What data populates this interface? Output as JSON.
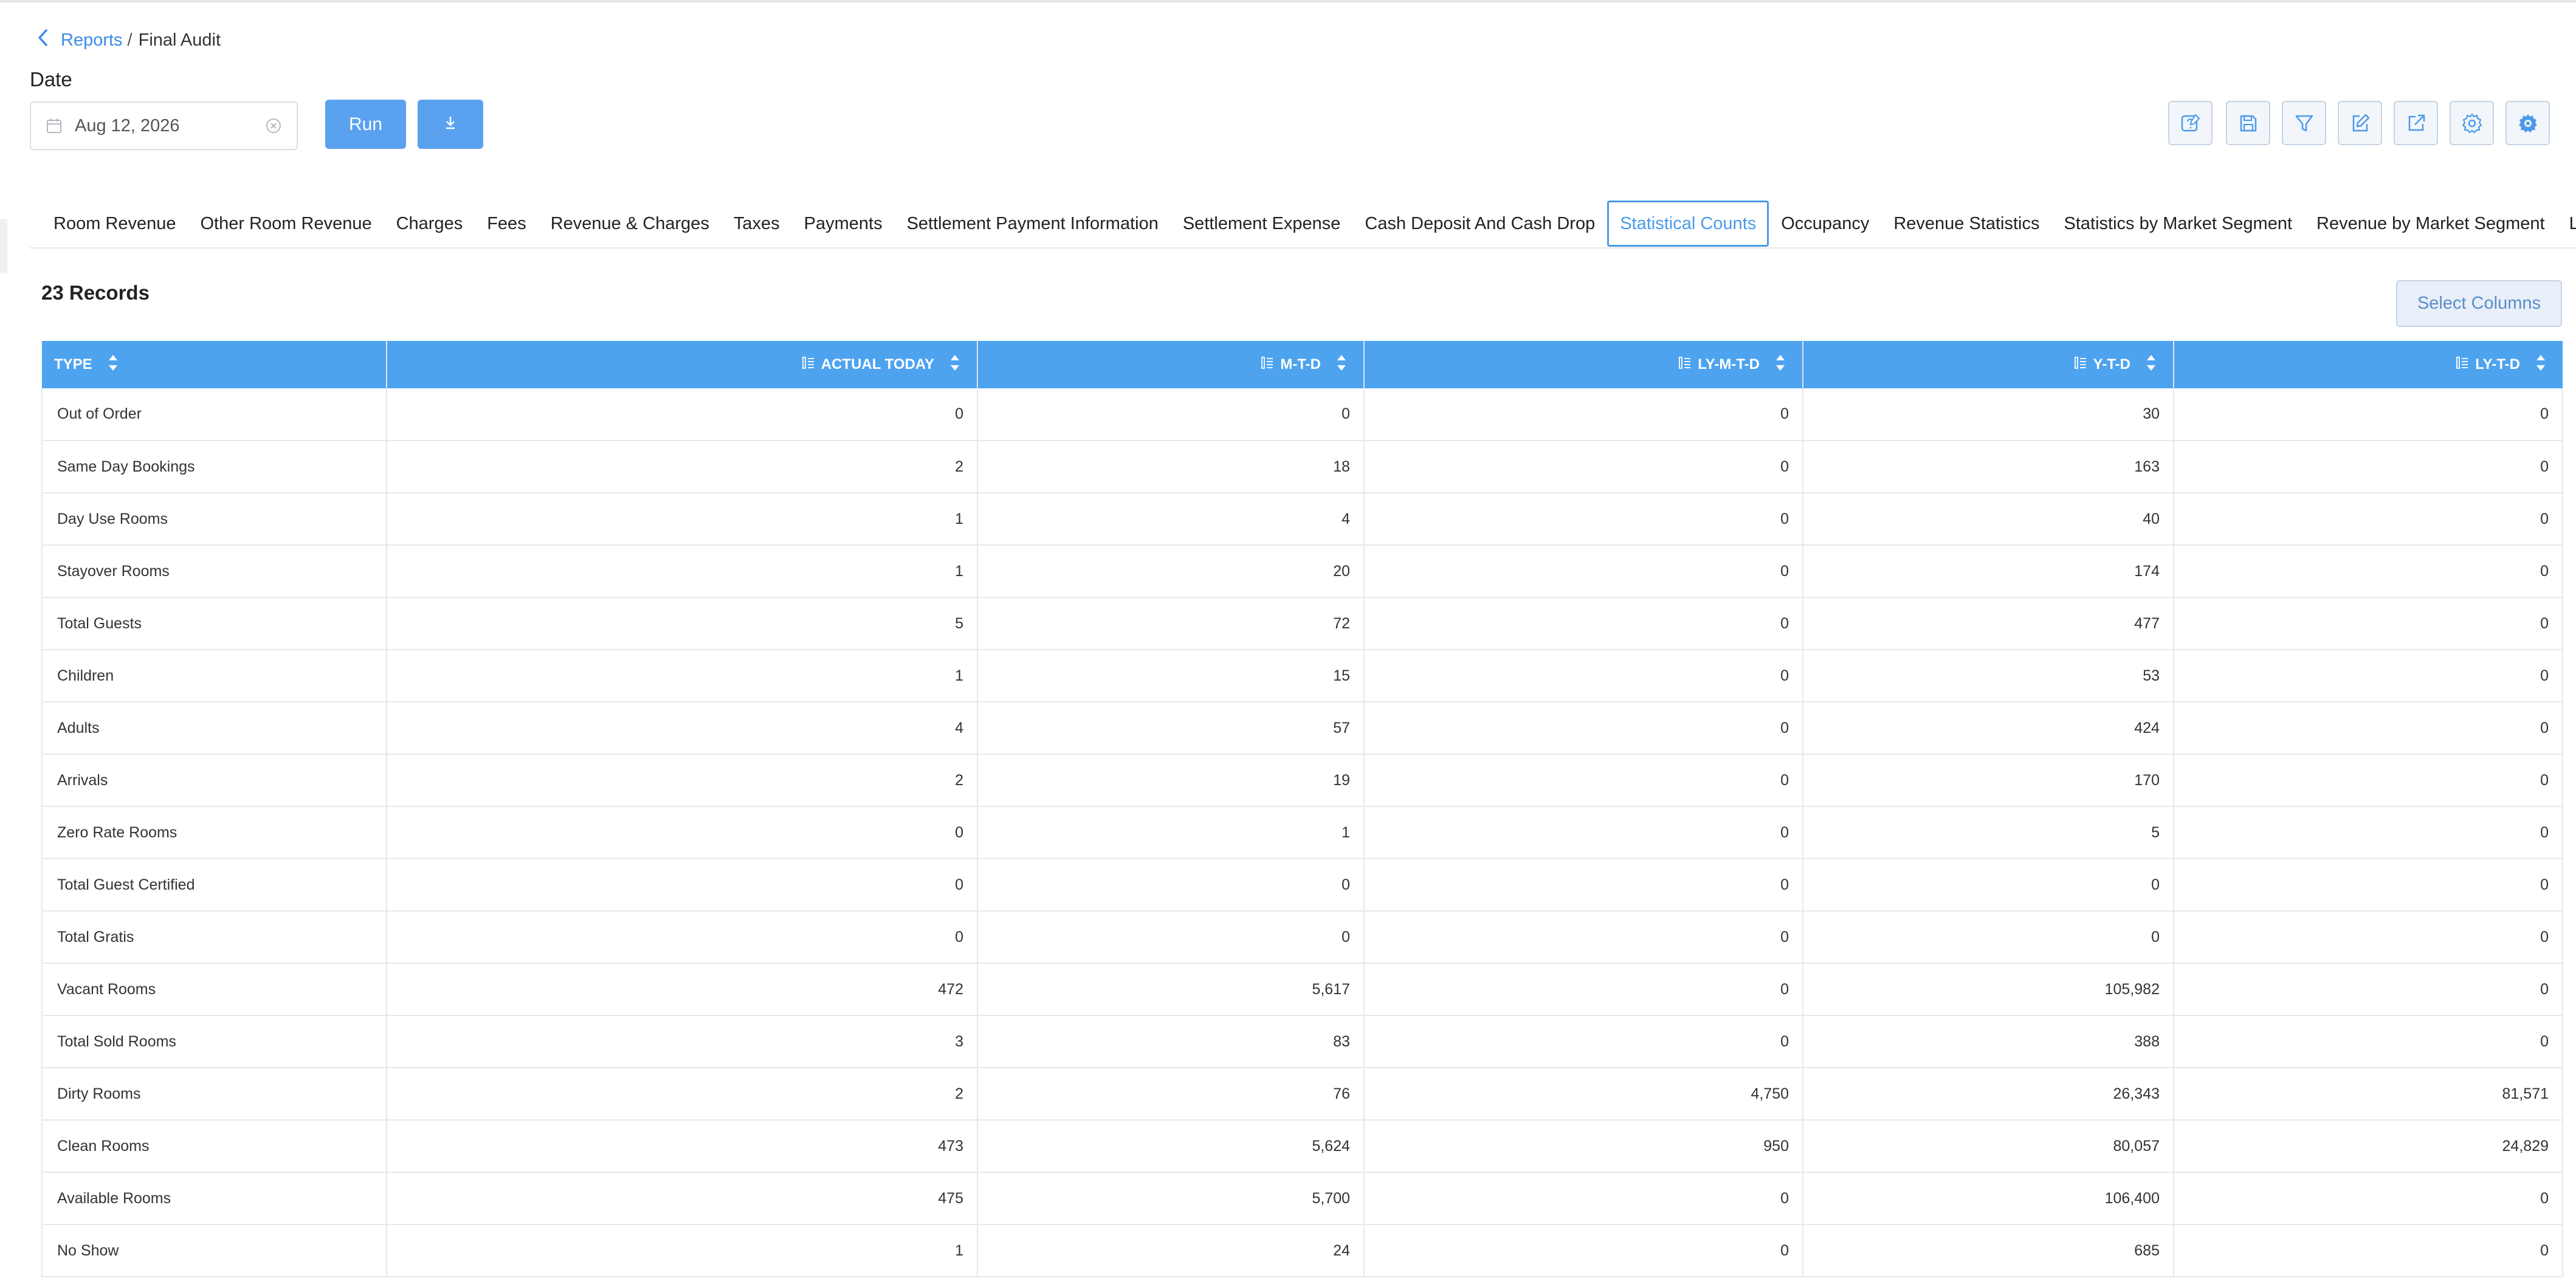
{
  "breadcrumb": {
    "parent": "Reports",
    "separator": "/",
    "current": "Final Audit"
  },
  "filter": {
    "date_label": "Date",
    "date_value": "Aug 12, 2026"
  },
  "actions": {
    "run_label": "Run"
  },
  "toolbar_icons": [
    "help-edit-icon",
    "save-icon",
    "filter-icon",
    "edit-icon",
    "external-link-icon",
    "settings-icon",
    "gear-settings-icon"
  ],
  "tabs": [
    "Room Revenue",
    "Other Room Revenue",
    "Charges",
    "Fees",
    "Revenue & Charges",
    "Taxes",
    "Payments",
    "Settlement Payment Information",
    "Settlement Expense",
    "Cash Deposit And Cash Drop",
    "Statistical Counts",
    "Occupancy",
    "Revenue Statistics",
    "Statistics by Market Segment",
    "Revenue by Market Segment",
    "Local M"
  ],
  "active_tab": "Statistical Counts",
  "records_label": "23 Records",
  "select_columns_label": "Select Columns",
  "table": {
    "headers": [
      "TYPE",
      "ACTUAL TODAY",
      "M-T-D",
      "LY-M-T-D",
      "Y-T-D",
      "LY-T-D"
    ],
    "rows": [
      [
        "Out of Order",
        "0",
        "0",
        "0",
        "30",
        "0"
      ],
      [
        "Same Day Bookings",
        "2",
        "18",
        "0",
        "163",
        "0"
      ],
      [
        "Day Use Rooms",
        "1",
        "4",
        "0",
        "40",
        "0"
      ],
      [
        "Stayover Rooms",
        "1",
        "20",
        "0",
        "174",
        "0"
      ],
      [
        "Total Guests",
        "5",
        "72",
        "0",
        "477",
        "0"
      ],
      [
        "Children",
        "1",
        "15",
        "0",
        "53",
        "0"
      ],
      [
        "Adults",
        "4",
        "57",
        "0",
        "424",
        "0"
      ],
      [
        "Arrivals",
        "2",
        "19",
        "0",
        "170",
        "0"
      ],
      [
        "Zero Rate Rooms",
        "0",
        "1",
        "0",
        "5",
        "0"
      ],
      [
        "Total Guest Certified",
        "0",
        "0",
        "0",
        "0",
        "0"
      ],
      [
        "Total Gratis",
        "0",
        "0",
        "0",
        "0",
        "0"
      ],
      [
        "Vacant Rooms",
        "472",
        "5,617",
        "0",
        "105,982",
        "0"
      ],
      [
        "Total Sold Rooms",
        "3",
        "83",
        "0",
        "388",
        "0"
      ],
      [
        "Dirty Rooms",
        "2",
        "76",
        "4,750",
        "26,343",
        "81,571"
      ],
      [
        "Clean Rooms",
        "473",
        "5,624",
        "950",
        "80,057",
        "24,829"
      ],
      [
        "Available Rooms",
        "475",
        "5,700",
        "0",
        "106,400",
        "0"
      ],
      [
        "No Show",
        "1",
        "24",
        "0",
        "685",
        "0"
      ]
    ]
  },
  "colors": {
    "accent": "#4ea3ef",
    "button": "#5aa1ef",
    "link": "#3b8be8"
  }
}
